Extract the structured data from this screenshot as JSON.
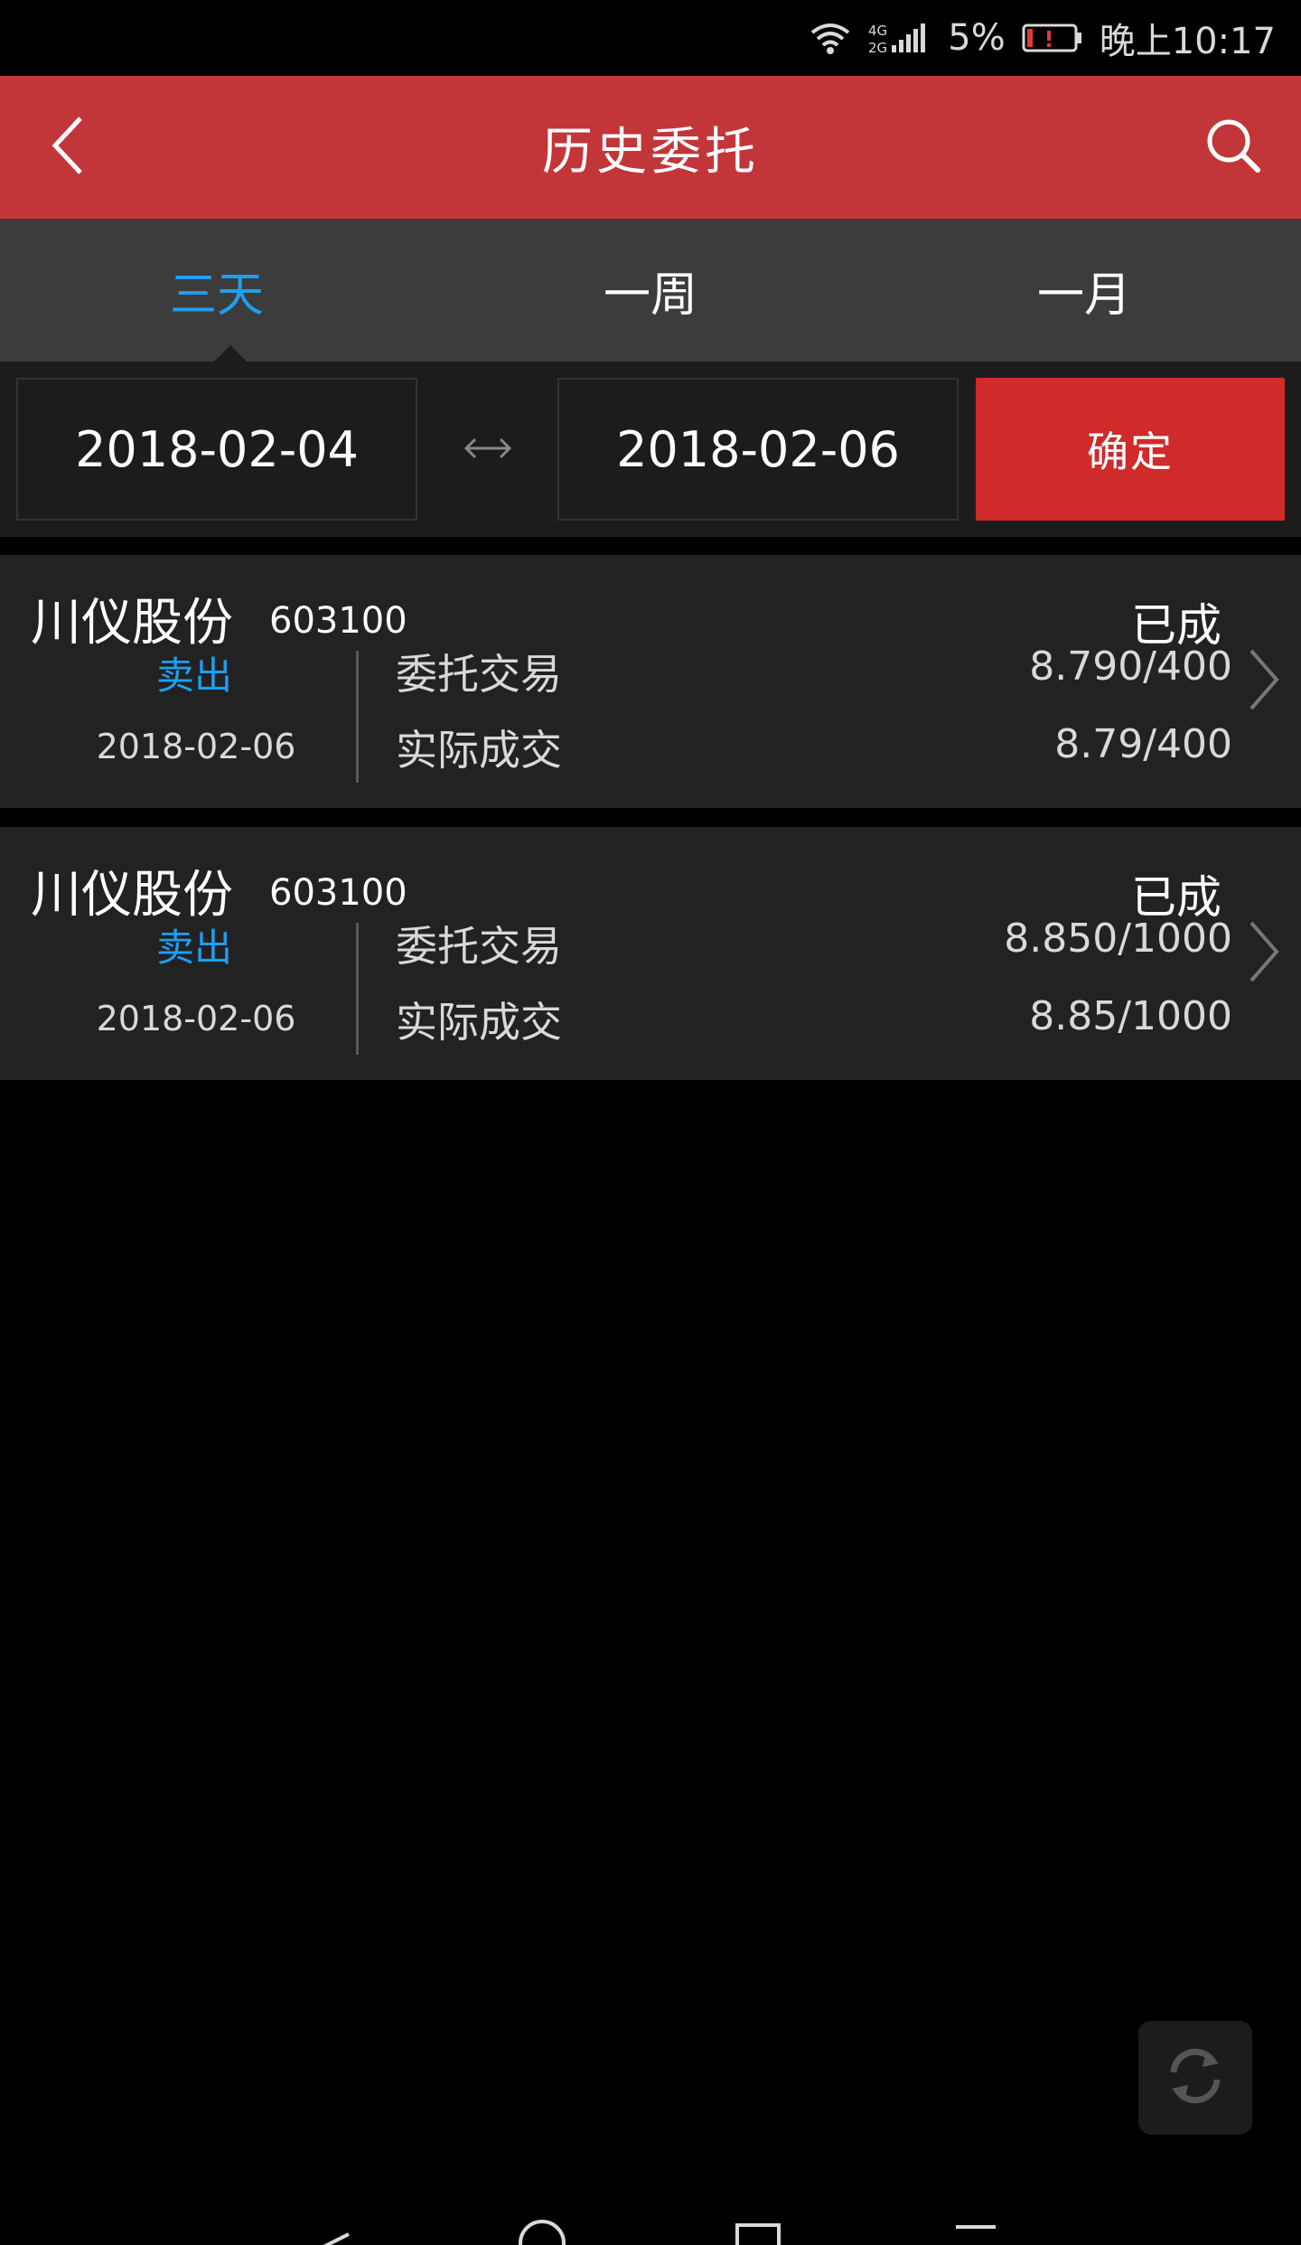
{
  "status_bar": {
    "network": "4G 2G",
    "battery": "5%",
    "time": "晚上10:17"
  },
  "header": {
    "title": "历史委托"
  },
  "tabs": [
    {
      "label": "三天",
      "active": true
    },
    {
      "label": "一周",
      "active": false
    },
    {
      "label": "一月",
      "active": false
    }
  ],
  "date_range": {
    "start": "2018-02-04",
    "end": "2018-02-06",
    "confirm_label": "确定"
  },
  "orders": [
    {
      "name": "川仪股份",
      "code": "603100",
      "side": "卖出",
      "date": "2018-02-06",
      "entrust_label": "委托交易",
      "deal_label": "实际成交",
      "status": "已成",
      "entrust_value": "8.790/400",
      "deal_value": "8.79/400"
    },
    {
      "name": "川仪股份",
      "code": "603100",
      "side": "卖出",
      "date": "2018-02-06",
      "entrust_label": "委托交易",
      "deal_label": "实际成交",
      "status": "已成",
      "entrust_value": "8.850/1000",
      "deal_value": "8.85/1000"
    }
  ],
  "colors": {
    "header_bg": "#c2363a",
    "confirm_bg": "#d02a2a",
    "accent_blue": "#1e9ff2",
    "card_bg": "#222222",
    "tab_bg": "#3c3c3c"
  },
  "icons": {
    "back": "chevron-left-icon",
    "search": "search-icon",
    "swap": "double-arrow-icon",
    "row_chevron": "chevron-right-icon",
    "refresh": "refresh-icon"
  }
}
